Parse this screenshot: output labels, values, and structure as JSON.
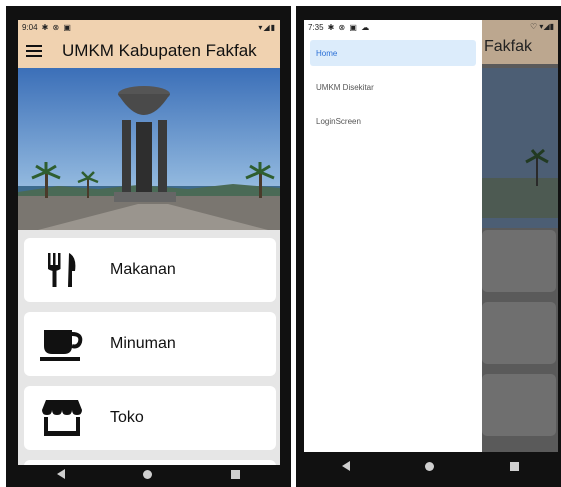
{
  "left_screen": {
    "status": {
      "time": "9:04",
      "icons": "✱ ⊗ ▣",
      "right_icons": "▾◢▮"
    },
    "appbar": {
      "title": "UMKM Kabupaten Fakfak"
    },
    "categories": [
      {
        "label": "Makanan",
        "icon": "utensils-icon"
      },
      {
        "label": "Minuman",
        "icon": "coffee-cup-icon"
      },
      {
        "label": "Toko",
        "icon": "store-icon"
      }
    ]
  },
  "right_screen": {
    "status": {
      "time": "7:35",
      "icons": "✱ ⊗ ▣ ☁",
      "right_icons": "♡ ▾◢▮"
    },
    "appbar_partial_title": "Fakfak",
    "drawer": {
      "items": [
        {
          "label": "Home",
          "active": true
        },
        {
          "label": "UMKM Disekitar",
          "active": false
        },
        {
          "label": "LoginScreen",
          "active": false
        }
      ]
    }
  },
  "colors": {
    "appbar": "#f0d2b0",
    "drawer_active_bg": "#dcecfb",
    "drawer_active_text": "#2a6fd6"
  }
}
